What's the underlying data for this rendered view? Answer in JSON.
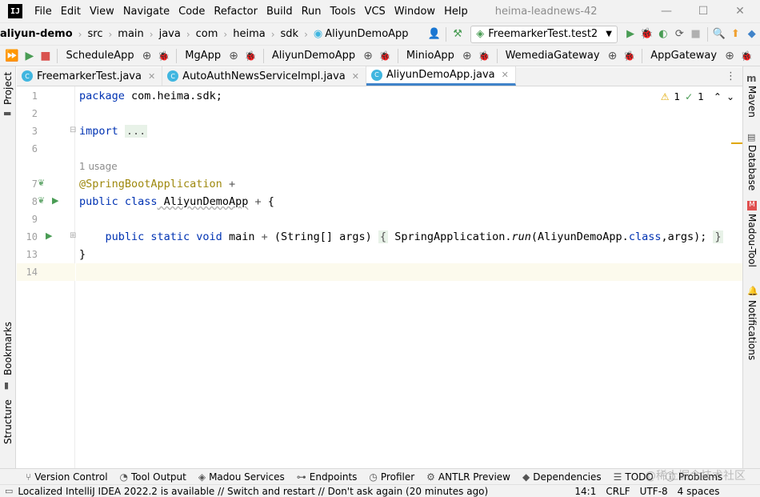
{
  "menubar": {
    "logo": "IJ",
    "items": [
      "File",
      "Edit",
      "View",
      "Navigate",
      "Code",
      "Refactor",
      "Build",
      "Run",
      "Tools",
      "VCS",
      "Window",
      "Help"
    ],
    "window_title": "heima-leadnews-42"
  },
  "navbar": {
    "breadcrumbs": [
      "aliyun-demo",
      "src",
      "main",
      "java",
      "com",
      "heima",
      "sdk",
      "AliyunDemoApp"
    ],
    "run_config": "FreemarkerTest.test2"
  },
  "services": [
    "ScheduleApp",
    "MgApp",
    "AliyunDemoApp",
    "MinioApp",
    "WemediaGateway",
    "AppGateway"
  ],
  "tabs": [
    {
      "label": "FreemarkerTest.java",
      "active": false
    },
    {
      "label": "AutoAuthNewsServiceImpl.java",
      "active": false
    },
    {
      "label": "AliyunDemoApp.java",
      "active": true
    }
  ],
  "editor": {
    "line_numbers": [
      "1",
      "2",
      "3",
      "6",
      "7",
      "8",
      "9",
      "10",
      "13",
      "14"
    ],
    "lines": {
      "l1_kw": "package",
      "l1_rest": " com.heima.sdk;",
      "l3_kw": "import",
      "l3_fold": "...",
      "usage": "1 usage",
      "l7": "@SpringBootApplication",
      "l8_kw": "public class",
      "l8_name": " AliyunDemoApp",
      "l8_brace": " {",
      "l10_kw": "public static void",
      "l10_name": " main",
      "l10_params": " (String[] args) ",
      "l10_body_open": "{",
      "l10_call1": " SpringApplication.",
      "l10_run": "run",
      "l10_call2": "(AliyunDemoApp.",
      "l10_class": "class",
      "l10_call3": ",args); ",
      "l10_body_close": "}",
      "l13": "}"
    },
    "inspections": {
      "warnings": "1",
      "typos": "1"
    }
  },
  "right_tools": [
    "Maven",
    "Database",
    "Madou-Tool",
    "Notifications"
  ],
  "left_tools": [
    "Project",
    "Bookmarks",
    "Structure"
  ],
  "toolwindows": [
    "Version Control",
    "Tool Output",
    "Madou Services",
    "Endpoints",
    "Profiler",
    "ANTLR Preview",
    "Dependencies",
    "TODO",
    "Problems"
  ],
  "status": {
    "message": "Localized IntelliJ IDEA 2022.2 is available // Switch and restart // Don't ask again (20 minutes ago)",
    "position": "14:1",
    "line_sep": "CRLF",
    "encoding": "UTF-8",
    "indent": "4 spaces"
  },
  "watermark": "@稀土掘金技术社区",
  "colors": {
    "accent": "#4083c9",
    "run_green": "#499c54",
    "keyword": "#0033b3",
    "annotation": "#9e880d"
  }
}
